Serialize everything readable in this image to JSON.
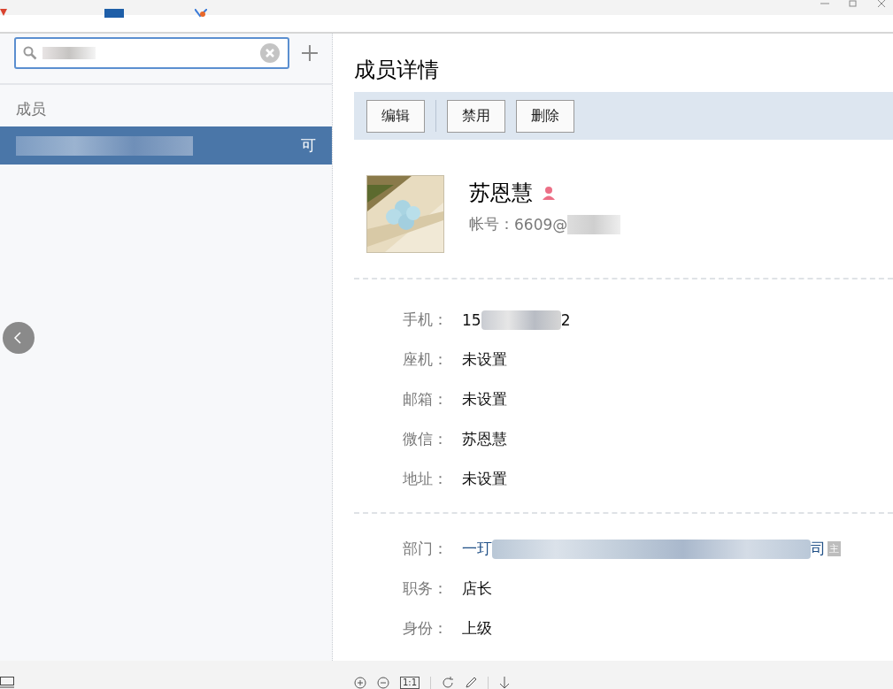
{
  "sidebar": {
    "section_title": "成员",
    "members": [
      {
        "name_tail": "可",
        "selected": true
      }
    ]
  },
  "detail": {
    "title": "成员详情",
    "actions": [
      "编辑",
      "禁用",
      "删除"
    ],
    "profile": {
      "name": "苏恩慧",
      "account_label": "帐号：",
      "account_value": "6609@"
    },
    "contact_fields": [
      {
        "label": "手机：",
        "value_parts": [
          "15",
          "2"
        ]
      },
      {
        "label": "座机：",
        "value_parts": [
          "未设置"
        ]
      },
      {
        "label": "邮箱：",
        "value_parts": [
          "未设置"
        ]
      },
      {
        "label": "微信：",
        "value_parts": [
          "苏恩慧"
        ]
      },
      {
        "label": "地址：",
        "value_parts": [
          "未设置"
        ]
      }
    ],
    "org_fields": [
      {
        "label": "部门：",
        "value_parts": [
          "一玎",
          "司"
        ],
        "badge": "主",
        "link": true
      },
      {
        "label": "职务：",
        "value_parts": [
          "店长"
        ],
        "link": false
      },
      {
        "label": "身份：",
        "value_parts": [
          "上级"
        ],
        "link": false
      }
    ]
  },
  "viewer_toolbar": {
    "actual_size_label": "1:1"
  }
}
